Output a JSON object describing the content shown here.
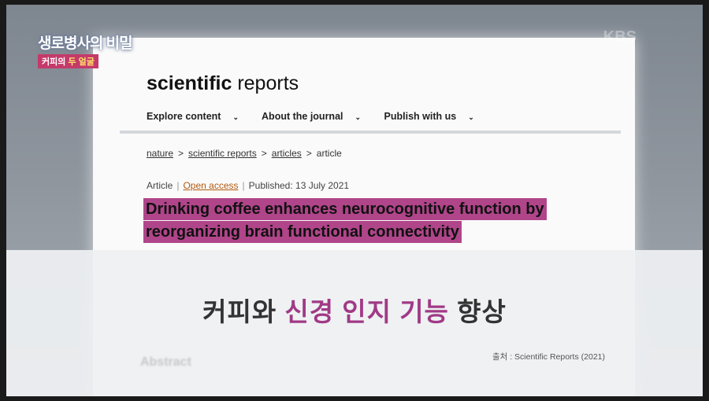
{
  "show": {
    "title": "생로병사의 비밀",
    "subtitle_prefix": "커피의",
    "subtitle_highlight": "두 얼굴"
  },
  "broadcaster": {
    "logo": "KBS"
  },
  "journal": {
    "logo_bold": "scientific",
    "logo_light": "reports"
  },
  "nav": {
    "items": [
      "Explore content",
      "About the journal",
      "Publish with us"
    ]
  },
  "breadcrumb": {
    "items": [
      "nature",
      "scientific reports",
      "articles"
    ],
    "current": "article"
  },
  "article": {
    "type": "Article",
    "access": "Open access",
    "published": "Published: 13 July 2021",
    "title_line1": "Drinking coffee enhances neurocognitive function by",
    "title_line2": "reorganizing brain functional connectivity"
  },
  "caption": {
    "part1": "커피와",
    "highlight": "신경 인지 기능",
    "part2": "향상"
  },
  "source": "출처 : Scientific Reports (2021)",
  "abstract_heading": "Abstract"
}
